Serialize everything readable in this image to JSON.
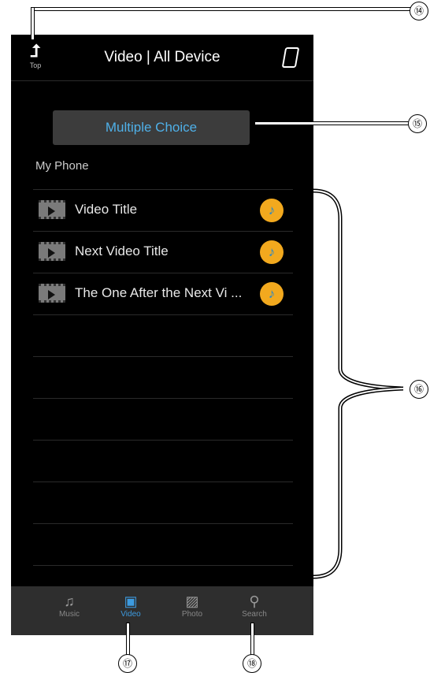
{
  "header": {
    "top_label": "Top",
    "title": "Video | All Device",
    "device_icon": "phone-icon"
  },
  "multiple_choice_label": "Multiple Choice",
  "section_title": "My Phone",
  "videos": [
    {
      "title": "Video Title",
      "icon": "film-icon",
      "badge": "music-note-icon"
    },
    {
      "title": "Next Video Title",
      "icon": "film-icon",
      "badge": "music-note-icon"
    },
    {
      "title": "The One After the Next Vi ...",
      "icon": "film-icon",
      "badge": "music-note-icon"
    }
  ],
  "tabs": [
    {
      "label": "Music",
      "icon": "music-icon"
    },
    {
      "label": "Video",
      "icon": "video-icon",
      "active": true
    },
    {
      "label": "Photo",
      "icon": "photo-icon"
    },
    {
      "label": "Search",
      "icon": "search-icon"
    }
  ],
  "callouts": [
    "⑭",
    "⑮",
    "⑯",
    "⑰",
    "⑱"
  ],
  "colors": {
    "accent": "#3d9be0",
    "badge": "#f2a91e",
    "background": "#000000"
  }
}
